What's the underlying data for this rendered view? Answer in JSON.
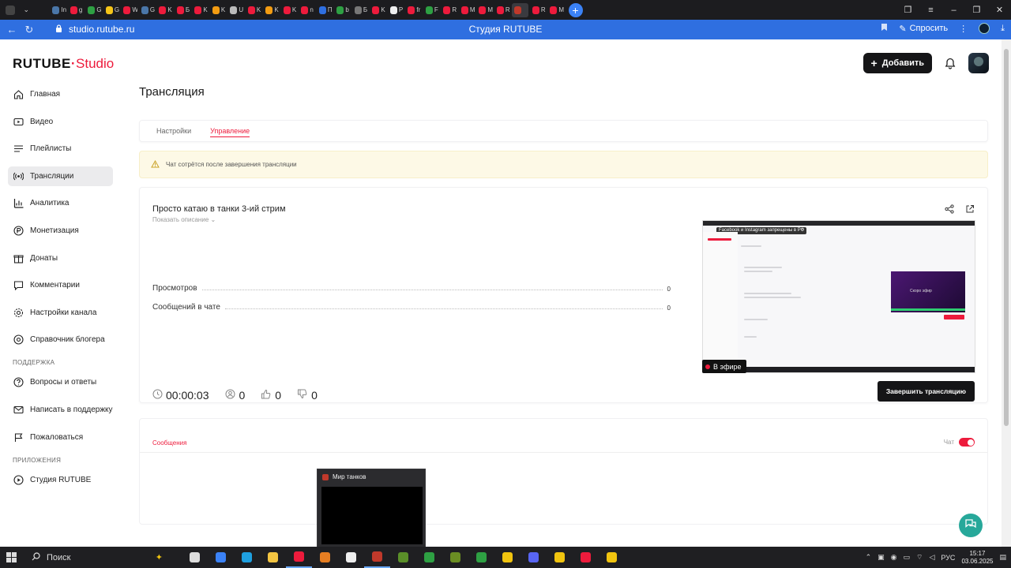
{
  "browser": {
    "tabs": [
      {
        "icon": "vk-icon",
        "color": "#4a76a8",
        "label": "In"
      },
      {
        "icon": "yandex-icon",
        "color": "#ed1b3c",
        "label": "g"
      },
      {
        "icon": "green-icon",
        "color": "#2ea043",
        "label": "G"
      },
      {
        "icon": "play-icon",
        "color": "#f5c518",
        "label": "G"
      },
      {
        "icon": "yandex-icon",
        "color": "#ed1b3c",
        "label": "W"
      },
      {
        "icon": "vk-icon",
        "color": "#4a76a8",
        "label": "G"
      },
      {
        "icon": "yandex-icon",
        "color": "#ed1b3c",
        "label": "K"
      },
      {
        "icon": "yandex-icon",
        "color": "#ed1b3c",
        "label": "Б"
      },
      {
        "icon": "yandex-icon",
        "color": "#ed1b3c",
        "label": "K"
      },
      {
        "icon": "mail-icon",
        "color": "#f39c12",
        "label": "K"
      },
      {
        "icon": "back-icon",
        "color": "#bbbbbb",
        "label": "U"
      },
      {
        "icon": "yandex-icon",
        "color": "#ed1b3c",
        "label": "K"
      },
      {
        "icon": "mail-icon",
        "color": "#f39c12",
        "label": "K"
      },
      {
        "icon": "yandex-icon",
        "color": "#ed1b3c",
        "label": "K"
      },
      {
        "icon": "yandex-icon",
        "color": "#ed1b3c",
        "label": "n"
      },
      {
        "icon": "mail-icon",
        "color": "#2f6fe0",
        "label": "П"
      },
      {
        "icon": "grid-icon",
        "color": "#2ea043",
        "label": "b"
      },
      {
        "icon": "grey-icon",
        "color": "#777777",
        "label": "Б"
      },
      {
        "icon": "red-icon",
        "color": "#ed1b3c",
        "label": "K"
      },
      {
        "icon": "arrow-icon",
        "color": "#eeeeee",
        "label": "P"
      },
      {
        "icon": "yandex-icon",
        "color": "#ed1b3c",
        "label": "fr"
      },
      {
        "icon": "green-icon",
        "color": "#2ea043",
        "label": "F"
      },
      {
        "icon": "rutube-icon",
        "color": "#ed1b3c",
        "label": "R"
      },
      {
        "icon": "mail-icon",
        "color": "#ed1b3c",
        "label": "M"
      },
      {
        "icon": "mail-icon",
        "color": "#ed1b3c",
        "label": "M"
      },
      {
        "icon": "rutube-icon",
        "color": "#ed1b3c",
        "label": "R"
      },
      {
        "icon": "rutube-studio-icon",
        "color": "#c0392b",
        "label": "",
        "active": true
      },
      {
        "icon": "rutube-icon",
        "color": "#ed1b3c",
        "label": "R"
      },
      {
        "icon": "mail-icon",
        "color": "#ed1b3c",
        "label": "M"
      }
    ],
    "url": "studio.rutube.ru",
    "page_title": "Студия RUTUBE",
    "ask_label": "Спросить"
  },
  "app": {
    "logo_main": "RUTUBE",
    "logo_sub": "Studio",
    "add_button": "Добавить",
    "sidebar": {
      "items": [
        {
          "label": "Главная",
          "icon": "home-icon"
        },
        {
          "label": "Видео",
          "icon": "video-icon"
        },
        {
          "label": "Плейлисты",
          "icon": "playlist-icon"
        },
        {
          "label": "Трансляции",
          "icon": "broadcast-icon",
          "active": true
        },
        {
          "label": "Аналитика",
          "icon": "analytics-icon"
        },
        {
          "label": "Монетизация",
          "icon": "monetization-icon"
        },
        {
          "label": "Донаты",
          "icon": "donate-icon"
        },
        {
          "label": "Комментарии",
          "icon": "comment-icon"
        },
        {
          "label": "Настройки канала",
          "icon": "settings-icon"
        },
        {
          "label": "Справочник блогера",
          "icon": "help-icon"
        }
      ],
      "support_title": "ПОДДЕРЖКА",
      "support_items": [
        {
          "label": "Вопросы и ответы",
          "icon": "faq-icon"
        },
        {
          "label": "Написать в поддержку",
          "icon": "mail-icon"
        },
        {
          "label": "Пожаловаться",
          "icon": "flag-icon"
        }
      ],
      "apps_title": "ПРИЛОЖЕНИЯ",
      "apps_items": [
        {
          "label": "Студия RUTUBE",
          "icon": "studio-app-icon"
        }
      ]
    },
    "page_title": "Трансляция",
    "tabs": [
      {
        "label": "Настройки",
        "active": false
      },
      {
        "label": "Управление",
        "active": true
      }
    ],
    "warning_text": "Чат сотрётся после завершения трансляции",
    "stream": {
      "title": "Просто катаю в танки 3-ий стрим",
      "show_description": "Показать описание",
      "stats": [
        {
          "label": "Просмотров",
          "value": "0"
        },
        {
          "label": "Сообщений в чате",
          "value": "0"
        }
      ],
      "preview_toast": "Facebook и Instagram запрещены в РФ",
      "preview_video_caption": "Скоро эфир",
      "live_badge": "В эфире",
      "timer": "00:00:03",
      "viewers": "0",
      "likes": "0",
      "dislikes": "0",
      "end_button": "Завершить трансляцию"
    },
    "messages": {
      "tab_label": "Сообщения",
      "chat_label": "Чат",
      "chat_enabled": true
    }
  },
  "taskbar": {
    "search_placeholder": "Поиск",
    "thumbnail_title": "Мир танков",
    "apps": [
      {
        "icon": "task-view-icon",
        "color": "#dddddd"
      },
      {
        "icon": "store-icon",
        "color": "#3b82f6"
      },
      {
        "icon": "edge-icon",
        "color": "#1fa0e0"
      },
      {
        "icon": "explorer-icon",
        "color": "#f4c542"
      },
      {
        "icon": "yandex-browser-icon",
        "color": "#ed1b3c",
        "open": true
      },
      {
        "icon": "game-icon",
        "color": "#e67e22"
      },
      {
        "icon": "terminal-icon",
        "color": "#eeeeee"
      },
      {
        "icon": "tanks-icon",
        "color": "#c0392b",
        "open": true
      },
      {
        "icon": "minecraft-icon",
        "color": "#5a8f29"
      },
      {
        "icon": "creeper-icon",
        "color": "#2ea043"
      },
      {
        "icon": "block-icon",
        "color": "#6b8e23"
      },
      {
        "icon": "xbox-icon",
        "color": "#2ea043"
      },
      {
        "icon": "layers-icon",
        "color": "#f1c40f"
      },
      {
        "icon": "discord-icon",
        "color": "#5865f2"
      },
      {
        "icon": "pointer-icon",
        "color": "#f1c40f"
      },
      {
        "icon": "obs-icon",
        "color": "#ed1b3c"
      },
      {
        "icon": "notepad-icon",
        "color": "#f1c40f"
      }
    ],
    "lang": "РУС",
    "time": "15:17",
    "date": "03.06.2025"
  }
}
